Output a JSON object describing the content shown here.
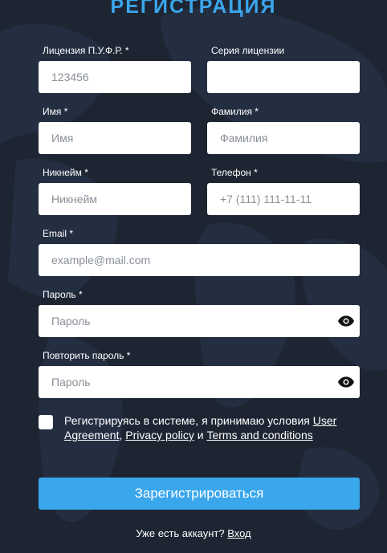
{
  "page": {
    "title": "РЕГИСТРАЦИЯ"
  },
  "form": {
    "license": {
      "label": "Лицензия П.У.Ф.Р. *",
      "placeholder": "123456"
    },
    "license_series": {
      "label": "Серия лицензии",
      "placeholder": ""
    },
    "first_name": {
      "label": "Имя *",
      "placeholder": "Имя"
    },
    "last_name": {
      "label": "Фамилия *",
      "placeholder": "Фамилия"
    },
    "nickname": {
      "label": "Никнейм *",
      "placeholder": "Никнейм"
    },
    "phone": {
      "label": "Телефон *",
      "placeholder": "+7 (111) 111-11-11"
    },
    "email": {
      "label": "Email *",
      "placeholder": "example@mail.com"
    },
    "password": {
      "label": "Пароль *",
      "placeholder": "Пароль",
      "icon": "eye-icon"
    },
    "password_repeat": {
      "label": "Повторить пароль *",
      "placeholder": "Пароль",
      "icon": "eye-icon"
    }
  },
  "terms": {
    "checked": false,
    "prefix": "Регистрируясь в системе, я принимаю условия ",
    "user_agreement": "User Agreement",
    "comma": ", ",
    "privacy_policy": "Privacy policy",
    "and": " и ",
    "terms_conditions": "Terms and conditions"
  },
  "submit_label": "Зарегистрироваться",
  "login": {
    "prompt": "Уже есть аккаунт? ",
    "link": "Вход"
  },
  "colors": {
    "background": "#1e2532",
    "accent": "#3aa6ec",
    "field": "#ffffff"
  }
}
